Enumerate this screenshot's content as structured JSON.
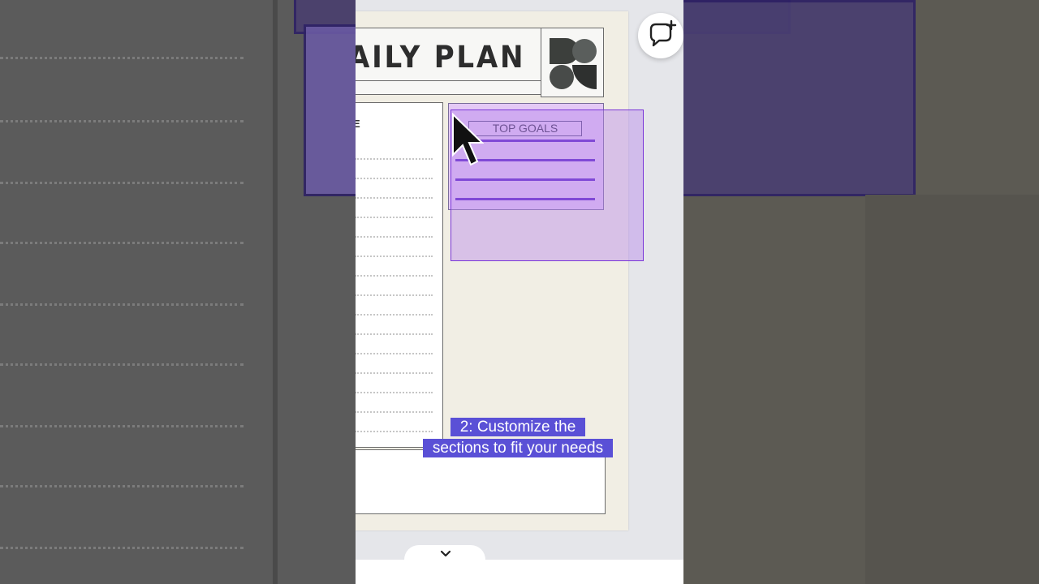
{
  "document": {
    "title": "AILY PLAN",
    "title_sub": "E",
    "list_header": "E",
    "goals_label": "TOP GOALS"
  },
  "caption": {
    "line1": "2: Customize the",
    "line2": "sections to fit your needs"
  },
  "icons": {
    "comment_add": "comment-add-icon",
    "chevron": "chevron-down-icon",
    "cursor": "mouse-pointer-icon",
    "logo": "geometric-shapes-logo"
  },
  "colors": {
    "caption_bg": "#5a50d6",
    "selection_fill": "#b482eb",
    "goal_line": "#5a1fc6",
    "page_bg": "#f1eee4"
  }
}
